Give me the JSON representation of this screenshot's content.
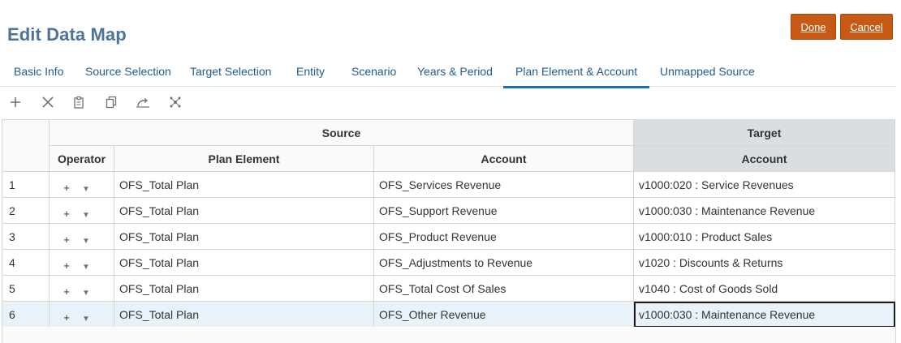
{
  "page": {
    "title": "Edit Data Map"
  },
  "actions": {
    "done_label": "Done",
    "cancel_label": "Cancel"
  },
  "tabs": [
    {
      "label": "Basic Info"
    },
    {
      "label": "Source Selection"
    },
    {
      "label": "Target Selection"
    },
    {
      "label": "Entity"
    },
    {
      "label": "Scenario"
    },
    {
      "label": "Years & Period"
    },
    {
      "label": "Plan Element & Account",
      "active": true
    },
    {
      "label": "Unmapped Source"
    }
  ],
  "toolbar": {
    "icons": [
      "add-icon",
      "delete-icon",
      "paste-icon",
      "copy-icon",
      "refresh-icon",
      "network-icon"
    ]
  },
  "table": {
    "group_headers": {
      "source": "Source",
      "target": "Target"
    },
    "columns": {
      "operator": "Operator",
      "plan_element": "Plan Element",
      "source_account": "Account",
      "target_account": "Account"
    },
    "operator_symbol": "+",
    "operator_caret": "▼",
    "rows": [
      {
        "num": "1",
        "plan_element": "OFS_Total Plan",
        "source_account": "OFS_Services Revenue",
        "target_account": "v1000:020 : Service Revenues"
      },
      {
        "num": "2",
        "plan_element": "OFS_Total Plan",
        "source_account": "OFS_Support Revenue",
        "target_account": "v1000:030 : Maintenance Revenue"
      },
      {
        "num": "3",
        "plan_element": "OFS_Total Plan",
        "source_account": "OFS_Product Revenue",
        "target_account": "v1000:010 : Product Sales"
      },
      {
        "num": "4",
        "plan_element": "OFS_Total Plan",
        "source_account": "OFS_Adjustments to Revenue",
        "target_account": "v1020 : Discounts & Returns"
      },
      {
        "num": "5",
        "plan_element": "OFS_Total Plan",
        "source_account": "OFS_Total Cost Of Sales",
        "target_account": "v1040 : Cost of Goods Sold"
      },
      {
        "num": "6",
        "plan_element": "OFS_Total Plan",
        "source_account": "OFS_Other Revenue",
        "target_account": "v1000:030 : Maintenance Revenue"
      }
    ]
  },
  "colors": {
    "accent": "#c65a14",
    "title": "#4d7399",
    "tab": "#1f5c8f",
    "tab_active_underline": "#1f6fb5",
    "selected_row": "#eaf2f9"
  }
}
